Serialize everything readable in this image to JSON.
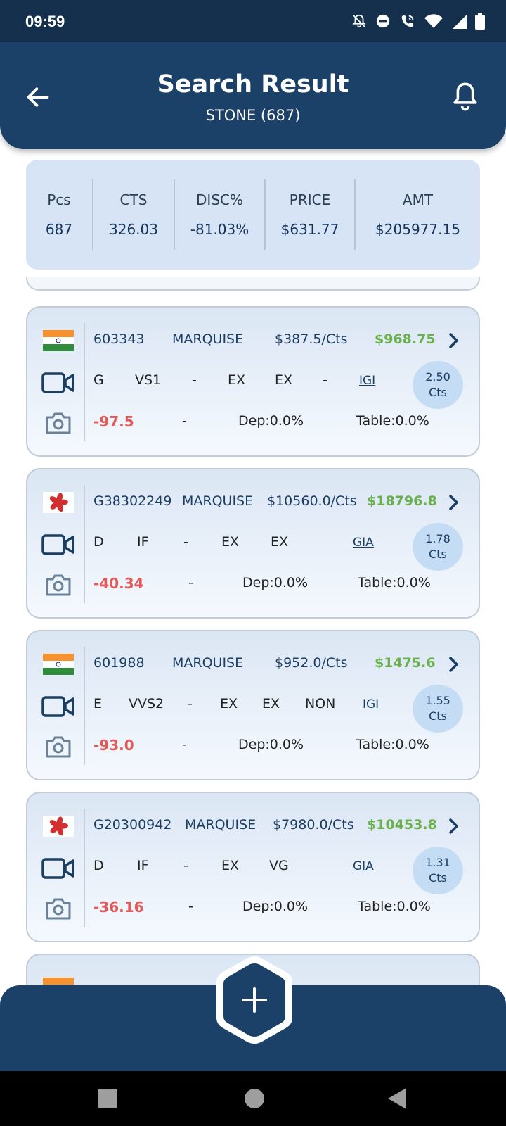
{
  "status_bar": {
    "time": "09:59",
    "icons": [
      "bell-off-icon",
      "do-not-disturb-icon",
      "wifi-call-icon",
      "wifi-icon",
      "signal-icon",
      "battery-icon"
    ]
  },
  "header": {
    "title": "Search Result",
    "subtitle": "STONE (687)",
    "back_icon": "arrow-left-icon",
    "notification_icon": "bell-icon",
    "bg_color": "#1b4168"
  },
  "summary": {
    "columns": [
      {
        "label": "Pcs",
        "value": "687"
      },
      {
        "label": "CTS",
        "value": "326.03"
      },
      {
        "label": "DISC%",
        "value": "-81.03%"
      },
      {
        "label": "PRICE",
        "value": "$631.77"
      },
      {
        "label": "AMT",
        "value": "$205977.15"
      }
    ]
  },
  "stones": [
    {
      "flag": "india",
      "stone_id": "603343",
      "shape": "MARQUISE",
      "price_per_ct": "$387.5/Cts",
      "amount": "$968.75",
      "color": "G",
      "clarity": "VS1",
      "cut": "-",
      "polish": "EX",
      "symmetry": "EX",
      "fluorescence": "-",
      "lab": "IGI",
      "carats": "2.50",
      "cts_unit": "Cts",
      "discount": "-97.5",
      "dash": "-",
      "depth": "Dep:0.0%",
      "table": "Table:0.0%"
    },
    {
      "flag": "hong-kong",
      "stone_id": "G38302249",
      "shape": "MARQUISE",
      "price_per_ct": "$10560.0/Cts",
      "amount": "$18796.8",
      "color": "D",
      "clarity": "IF",
      "cut": "-",
      "polish": "EX",
      "symmetry": "EX",
      "fluorescence": "",
      "lab": "GIA",
      "carats": "1.78",
      "cts_unit": "Cts",
      "discount": "-40.34",
      "dash": "-",
      "depth": "Dep:0.0%",
      "table": "Table:0.0%"
    },
    {
      "flag": "india",
      "stone_id": "601988",
      "shape": "MARQUISE",
      "price_per_ct": "$952.0/Cts",
      "amount": "$1475.6",
      "color": "E",
      "clarity": "VVS2",
      "cut": "-",
      "polish": "EX",
      "symmetry": "EX",
      "fluorescence": "NON",
      "lab": "IGI",
      "carats": "1.55",
      "cts_unit": "Cts",
      "discount": "-93.0",
      "dash": "-",
      "depth": "Dep:0.0%",
      "table": "Table:0.0%"
    },
    {
      "flag": "hong-kong",
      "stone_id": "G20300942",
      "shape": "MARQUISE",
      "price_per_ct": "$7980.0/Cts",
      "amount": "$10453.8",
      "color": "D",
      "clarity": "IF",
      "cut": "-",
      "polish": "EX",
      "symmetry": "VG",
      "fluorescence": "",
      "lab": "GIA",
      "carats": "1.31",
      "cts_unit": "Cts",
      "discount": "-36.16",
      "dash": "-",
      "depth": "Dep:0.0%",
      "table": "Table:0.0%"
    }
  ],
  "fab": {
    "icon": "plus-icon"
  },
  "nav": {
    "icons": [
      "recents-square-icon",
      "home-circle-icon",
      "back-triangle-icon"
    ]
  },
  "colors": {
    "accent_green": "#6ab04c",
    "discount_red": "#e05a5a",
    "navy": "#1b4168"
  }
}
